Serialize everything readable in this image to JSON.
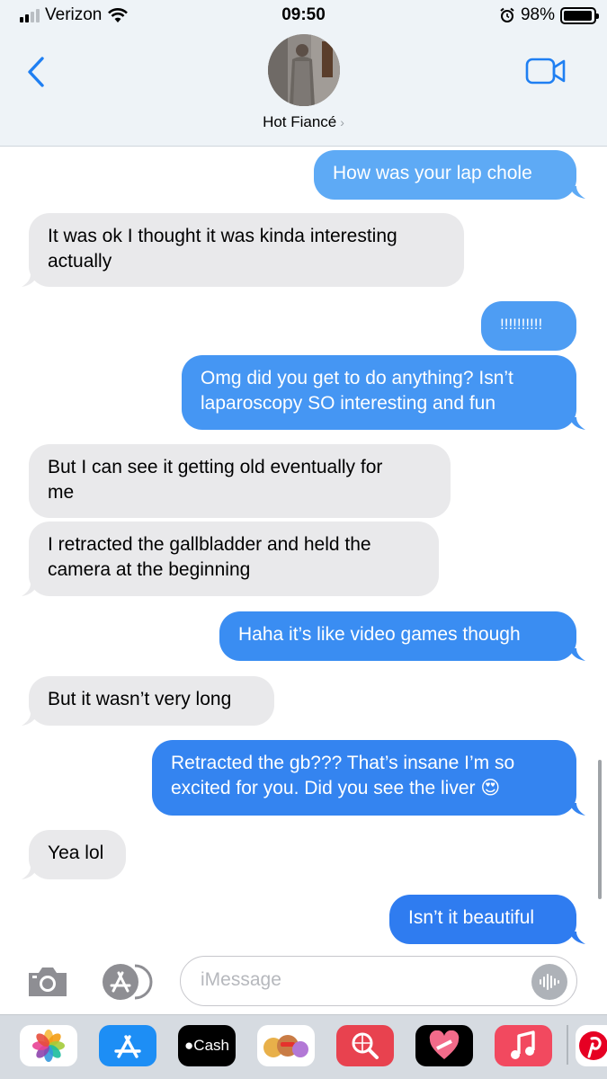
{
  "status_bar": {
    "carrier": "Verizon",
    "time": "09:50",
    "battery": "98%",
    "battery_level": 0.98
  },
  "header": {
    "contact_name": "Hot Fiancé",
    "chevron": "›",
    "back_icon": "chevron-left-icon",
    "video_icon": "video-camera-icon"
  },
  "colors": {
    "sent_light": "#5eaaf5",
    "sent_dark": "#2f7cf0",
    "received": "#e9e9eb",
    "ios_blue": "#1f7ff2"
  },
  "messages": [
    {
      "dir": "out",
      "text": "How was your lap chole"
    },
    {
      "dir": "in",
      "text": "It was ok I thought it was kinda interesting\nactually"
    },
    {
      "dir": "out",
      "text": "!!!!!!!!!!"
    },
    {
      "dir": "out",
      "text": "Omg did you get to do anything? Isn’t\nlaparoscopy SO interesting and fun"
    },
    {
      "dir": "in",
      "text": "But I can see it getting old eventually for\nme"
    },
    {
      "dir": "in",
      "text": "I retracted the gallbladder and held the\ncamera at the beginning"
    },
    {
      "dir": "out",
      "text": "Haha it’s like video games though"
    },
    {
      "dir": "in",
      "text": "But it wasn’t very long"
    },
    {
      "dir": "out",
      "text": "Retracted the gb??? That’s insane I’m so\nexcited for you. Did you see the liver 😍"
    },
    {
      "dir": "in",
      "text": "Yea lol"
    },
    {
      "dir": "out",
      "text": "Isn’t it beautiful"
    }
  ],
  "composer": {
    "placeholder": "iMessage",
    "camera_icon": "camera-icon",
    "apps_icon": "app-store-icon",
    "audio_icon": "audio-waveform-icon"
  },
  "app_drawer": [
    {
      "name": "photos-app-icon"
    },
    {
      "name": "app-store-app-icon"
    },
    {
      "name": "cash-app-icon",
      "label": "Cash"
    },
    {
      "name": "memoji-app-icon"
    },
    {
      "name": "search-images-app-icon"
    },
    {
      "name": "heart-sticker-app-icon"
    },
    {
      "name": "music-app-icon"
    },
    {
      "name": "pinterest-app-icon"
    }
  ]
}
